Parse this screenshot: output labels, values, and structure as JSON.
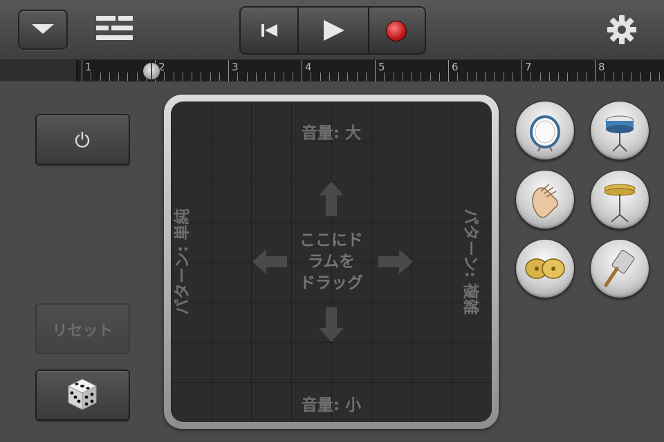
{
  "toolbar": {
    "menu": "menu-chevron",
    "tracks_view": "tracks-view-icon",
    "transport": [
      "rewind",
      "play",
      "record"
    ],
    "settings": "gear-icon"
  },
  "ruler": {
    "bars": [
      "1",
      "2",
      "3",
      "4",
      "5",
      "6",
      "7",
      "8"
    ],
    "playhead_position_bar": 1.8
  },
  "left_controls": {
    "power": "power-icon",
    "reset_label": "リセット",
    "randomize": "dice-icon"
  },
  "pad": {
    "top_label": "音量: 大",
    "bottom_label": "音量: 小",
    "left_label": "パターン: 単純",
    "right_label": "パターン: 複雑",
    "center_lines": [
      "ここにド",
      "ラムを",
      "ドラッグ"
    ]
  },
  "drums": [
    "kick-drum",
    "snare-drum",
    "clap",
    "hi-hat",
    "crash-cymbal",
    "shaker"
  ],
  "colors": {
    "record": "#c01818",
    "background": "#4a4a49",
    "pad": "#2b2c2b"
  }
}
